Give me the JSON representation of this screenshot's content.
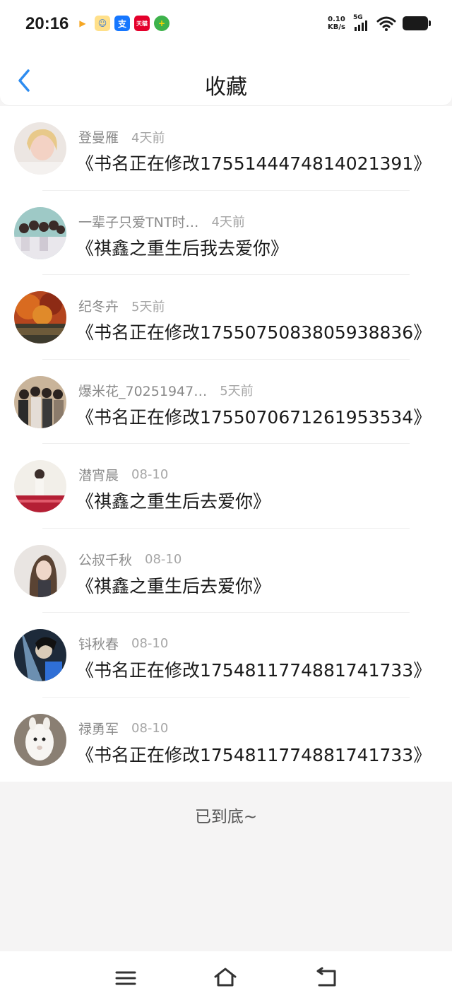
{
  "status_bar": {
    "time": "20:16",
    "net_speed_value": "0.10",
    "net_speed_unit": "KB/s",
    "network": "5G",
    "app_icons": [
      {
        "name": "video-app-icon",
        "glyph": "▶",
        "bg": "#ffffff",
        "fg": "#f5a623"
      },
      {
        "name": "cartoon-app-icon",
        "glyph": "☺",
        "bg": "#ffe08a",
        "fg": "#3a7bd5"
      },
      {
        "name": "alipay-icon",
        "glyph": "支",
        "bg": "#1677ff",
        "fg": "#ffffff"
      },
      {
        "name": "tmall-icon",
        "glyph": "天猫",
        "bg": "#e4002b",
        "fg": "#ffffff"
      },
      {
        "name": "plus-app-icon",
        "glyph": "+",
        "bg": "#3db24b",
        "fg": "#ffd400"
      }
    ]
  },
  "header": {
    "title": "收藏",
    "back_icon": "chevron-left-icon",
    "accent": "#2d8cf0"
  },
  "items": [
    {
      "user": "登曼雁",
      "time": "4天前",
      "book": "《书名正在修改1755144474814021391》"
    },
    {
      "user": "一辈子只爱TNT时…",
      "time": "4天前",
      "book": "《祺鑫之重生后我去爱你》"
    },
    {
      "user": "纪冬卉",
      "time": "5天前",
      "book": "《书名正在修改1755075083805938836》"
    },
    {
      "user": "爆米花_70251947…",
      "time": "5天前",
      "book": "《书名正在修改1755070671261953534》"
    },
    {
      "user": "潜宵晨",
      "time": "08-10",
      "book": "《祺鑫之重生后去爱你》"
    },
    {
      "user": "公叔千秋",
      "time": "08-10",
      "book": "《祺鑫之重生后去爱你》"
    },
    {
      "user": "钭秋春",
      "time": "08-10",
      "book": "《书名正在修改1754811774881741733》"
    },
    {
      "user": "禄勇军",
      "time": "08-10",
      "book": "《书名正在修改1754811774881741733》"
    }
  ],
  "footer": {
    "end_text": "已到底~"
  },
  "nav": {
    "menu_icon": "menu-icon",
    "home_icon": "home-icon",
    "back_icon": "back-icon"
  }
}
